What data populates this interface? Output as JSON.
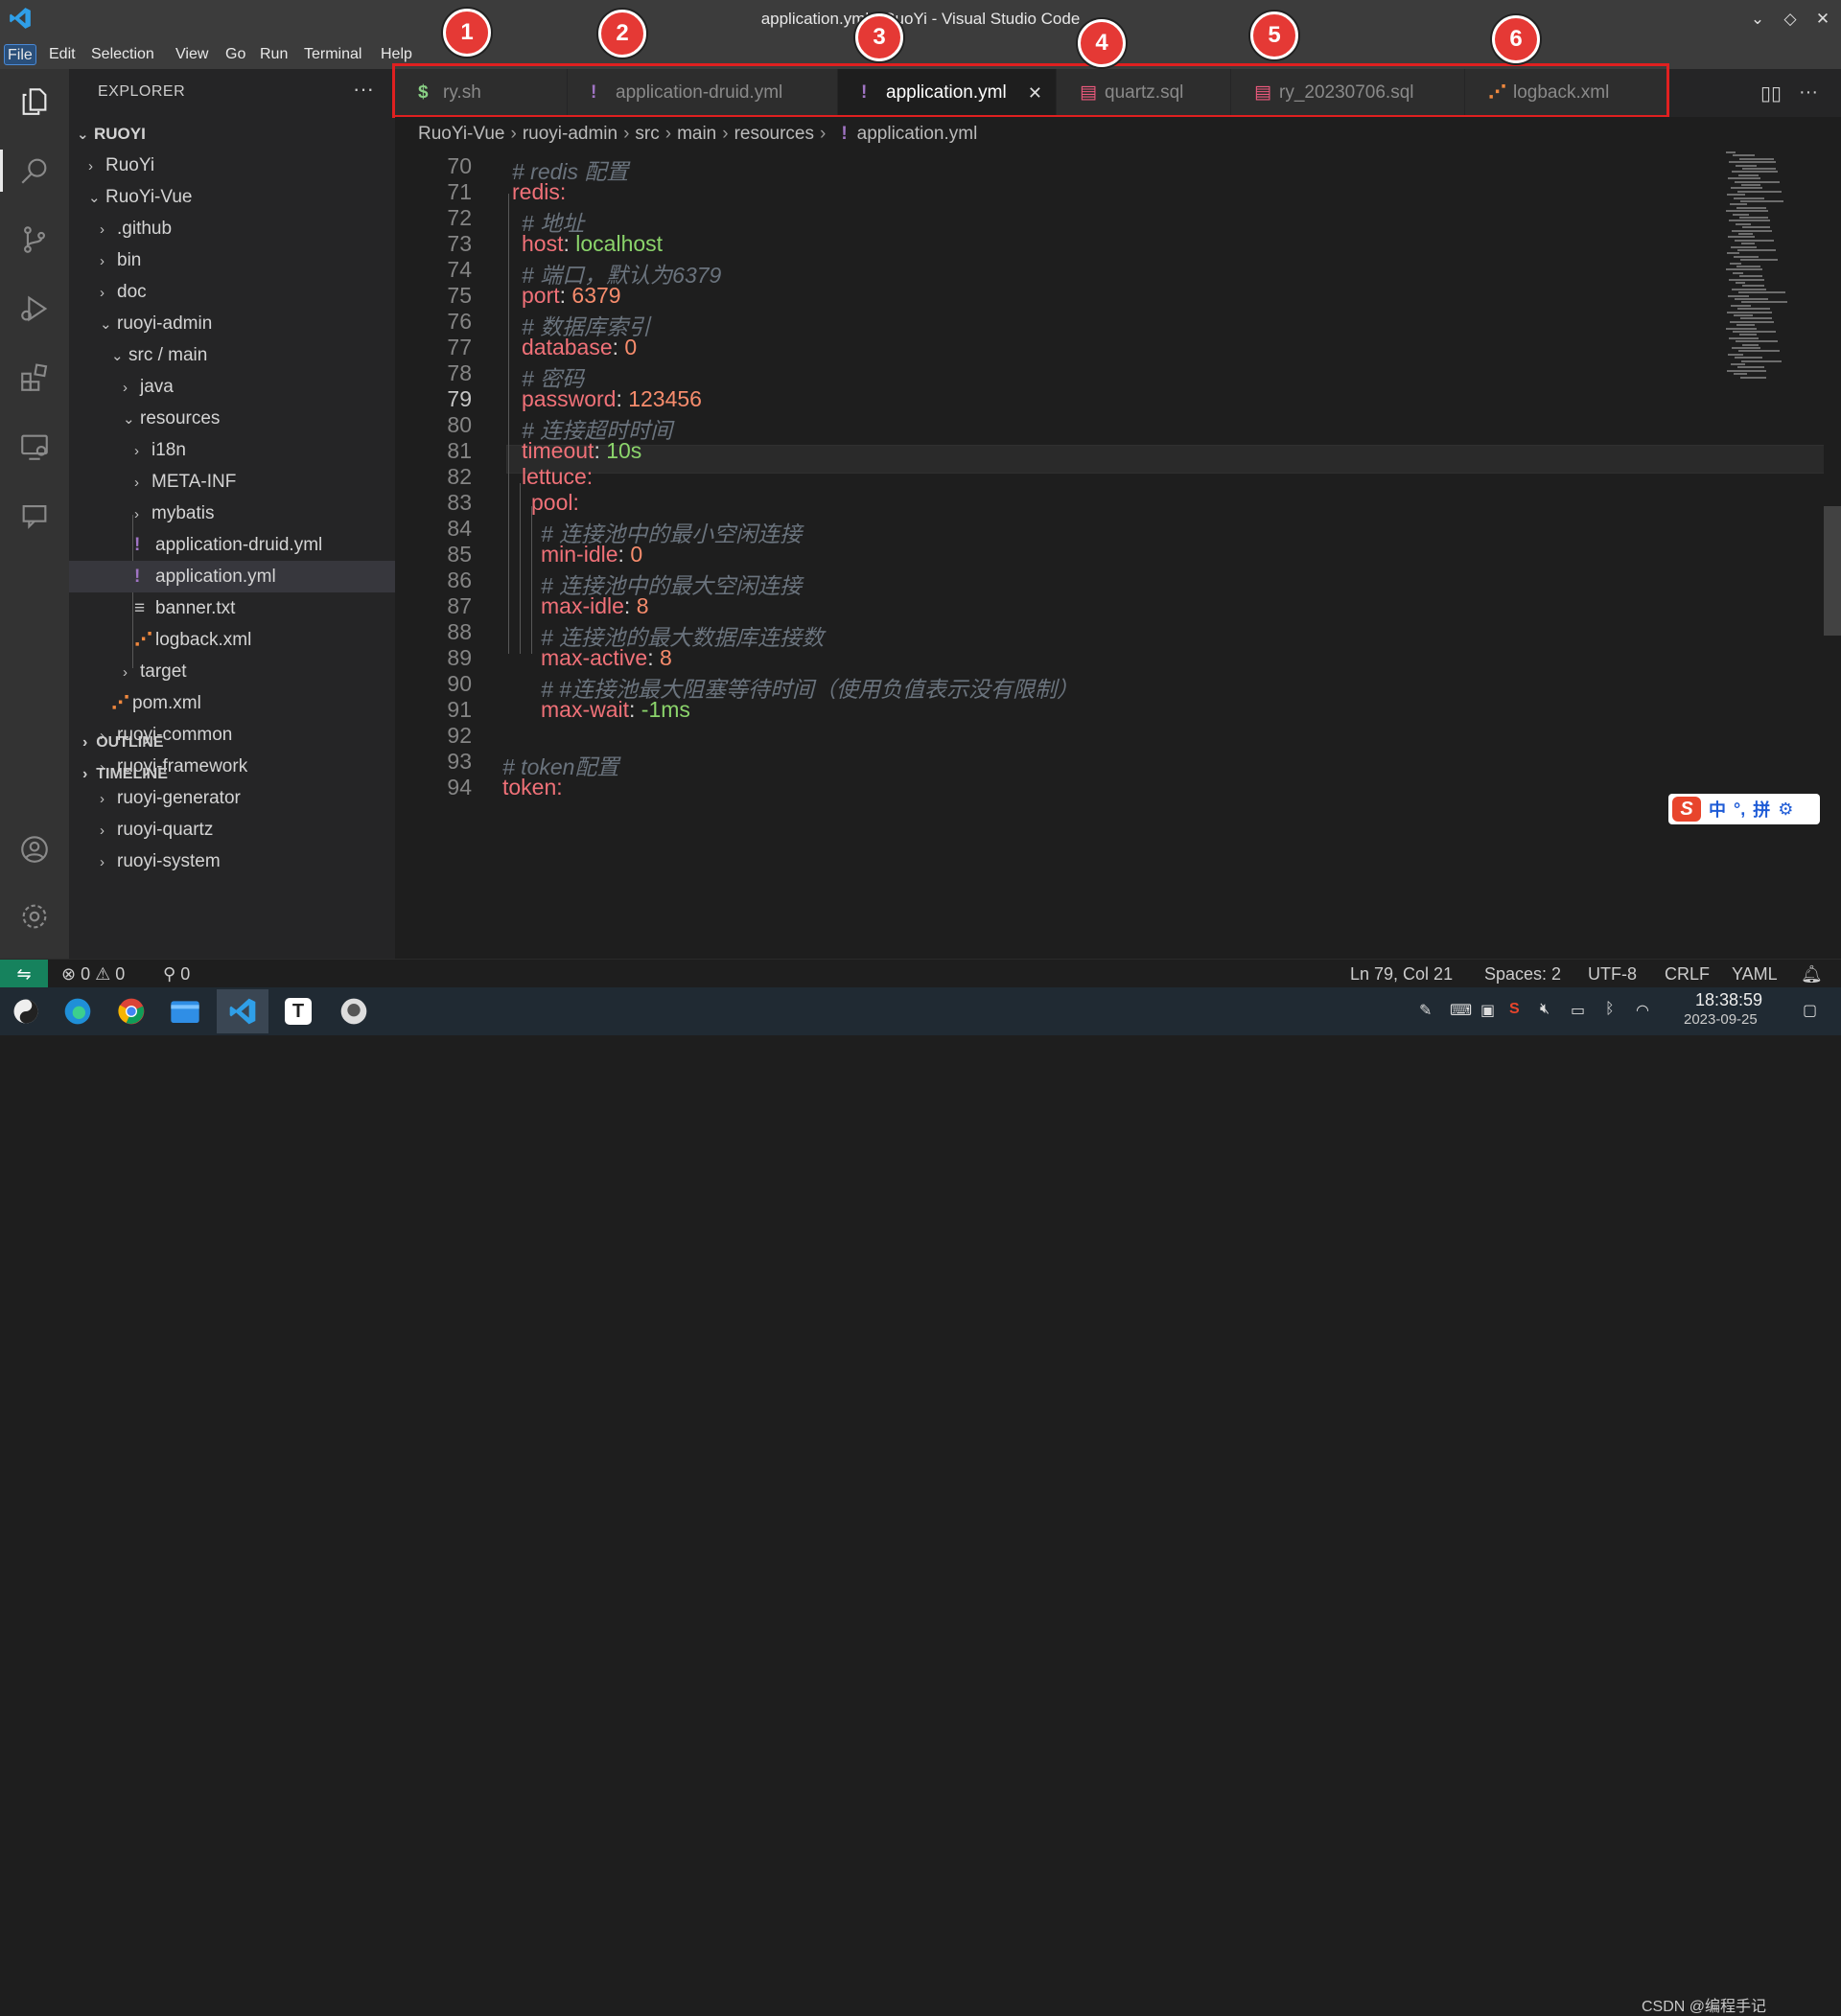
{
  "window": {
    "title": "application.yml - RuoYi - Visual Studio Code",
    "controls": [
      "chevron-down-icon",
      "restore-icon",
      "close-icon"
    ]
  },
  "menu": [
    "File",
    "Edit",
    "Selection",
    "View",
    "Go",
    "Run",
    "Terminal",
    "Help"
  ],
  "explorer": {
    "header": "EXPLORER",
    "more": "···",
    "root": "RUOYI",
    "tree": [
      {
        "label": "RuoYi",
        "chevron": "›"
      },
      {
        "label": "RuoYi-Vue",
        "chevron": "⌄"
      },
      {
        "label": ".github",
        "chevron": "›"
      },
      {
        "label": "bin",
        "chevron": "›"
      },
      {
        "label": "doc",
        "chevron": "›"
      },
      {
        "label": "ruoyi-admin",
        "chevron": "⌄"
      },
      {
        "label": "src / main",
        "chevron": "⌄"
      },
      {
        "label": "java",
        "chevron": "›"
      },
      {
        "label": "resources",
        "chevron": "⌄"
      },
      {
        "label": "i18n",
        "chevron": "›"
      },
      {
        "label": "META-INF",
        "chevron": "›"
      },
      {
        "label": "mybatis",
        "chevron": "›"
      },
      {
        "label": "application-druid.yml",
        "icon": "!"
      },
      {
        "label": "application.yml",
        "icon": "!"
      },
      {
        "label": "banner.txt",
        "icon": "≡"
      },
      {
        "label": "logback.xml",
        "icon": "⋰"
      },
      {
        "label": "target",
        "chevron": "›"
      },
      {
        "label": "pom.xml",
        "icon": "⋰"
      },
      {
        "label": "ruoyi-common",
        "chevron": "›"
      },
      {
        "label": "ruoyi-framework",
        "chevron": "›"
      },
      {
        "label": "ruoyi-generator",
        "chevron": "›"
      },
      {
        "label": "ruoyi-quartz",
        "chevron": "›"
      },
      {
        "label": "ruoyi-system",
        "chevron": "›"
      }
    ],
    "outline": "OUTLINE",
    "timeline": "TIMELINE"
  },
  "tabs": [
    {
      "label": "ry.sh",
      "icon": "$",
      "icon_color": "#89d185"
    },
    {
      "label": "application-druid.yml",
      "icon": "!",
      "icon_color": "#a074c4"
    },
    {
      "label": "application.yml",
      "icon": "!",
      "icon_color": "#a074c4",
      "close": "✕"
    },
    {
      "label": "quartz.sql",
      "icon": "▤",
      "icon_color": "#f05a7e"
    },
    {
      "label": "ry_20230706.sql",
      "icon": "▤",
      "icon_color": "#f05a7e"
    },
    {
      "label": "logback.xml",
      "icon": "⋰",
      "icon_color": "#f0883e"
    }
  ],
  "badges": [
    "1",
    "2",
    "3",
    "4",
    "5",
    "6"
  ],
  "breadcrumb": [
    "RuoYi-Vue",
    "ruoyi-admin",
    "src",
    "main",
    "resources",
    "application.yml"
  ],
  "code_lines": [
    {
      "n": "70",
      "text": "# redis 配置"
    },
    {
      "n": "71",
      "text": "redis:"
    },
    {
      "n": "72",
      "text": "# 地址"
    },
    {
      "n": "73",
      "key": "host",
      "val": "localhost"
    },
    {
      "n": "74",
      "text": "# 端口，默认为6379"
    },
    {
      "n": "75",
      "key": "port",
      "val": "6379"
    },
    {
      "n": "76",
      "text": "# 数据库索引"
    },
    {
      "n": "77",
      "key": "database",
      "val": "0"
    },
    {
      "n": "78",
      "text": "# 密码"
    },
    {
      "n": "79",
      "key": "password",
      "val": "123456"
    },
    {
      "n": "80",
      "text": "# 连接超时时间"
    },
    {
      "n": "81",
      "key": "timeout",
      "val": "10s"
    },
    {
      "n": "82",
      "text": "lettuce:"
    },
    {
      "n": "83",
      "text": "pool:"
    },
    {
      "n": "84",
      "text": "# 连接池中的最小空闲连接"
    },
    {
      "n": "85",
      "key": "min-idle",
      "val": "0"
    },
    {
      "n": "86",
      "text": "# 连接池中的最大空闲连接"
    },
    {
      "n": "87",
      "key": "max-idle",
      "val": "8"
    },
    {
      "n": "88",
      "text": "# 连接池的最大数据库连接数"
    },
    {
      "n": "89",
      "key": "max-active",
      "val": "8"
    },
    {
      "n": "90",
      "text": "# #连接池最大阻塞等待时间（使用负值表示没有限制）"
    },
    {
      "n": "91",
      "key": "max-wait",
      "val": "-1ms"
    },
    {
      "n": "92",
      "text": ""
    },
    {
      "n": "93",
      "text": "# token配置"
    },
    {
      "n": "94",
      "text": "token:"
    }
  ],
  "ime": {
    "lang": "中",
    "punct": "°,",
    "mode": "拼",
    "settings": "gear-icon"
  },
  "status": {
    "errors": "0",
    "warnings": "0",
    "ports": "0",
    "position": "Ln 79, Col 21",
    "spaces": "Spaces: 2",
    "encoding": "UTF-8",
    "eol": "CRLF",
    "language": "YAML"
  },
  "taskbar": {
    "time": "18:38:59",
    "date": "2023-09-25",
    "watermark": "CSDN @编程手记"
  }
}
